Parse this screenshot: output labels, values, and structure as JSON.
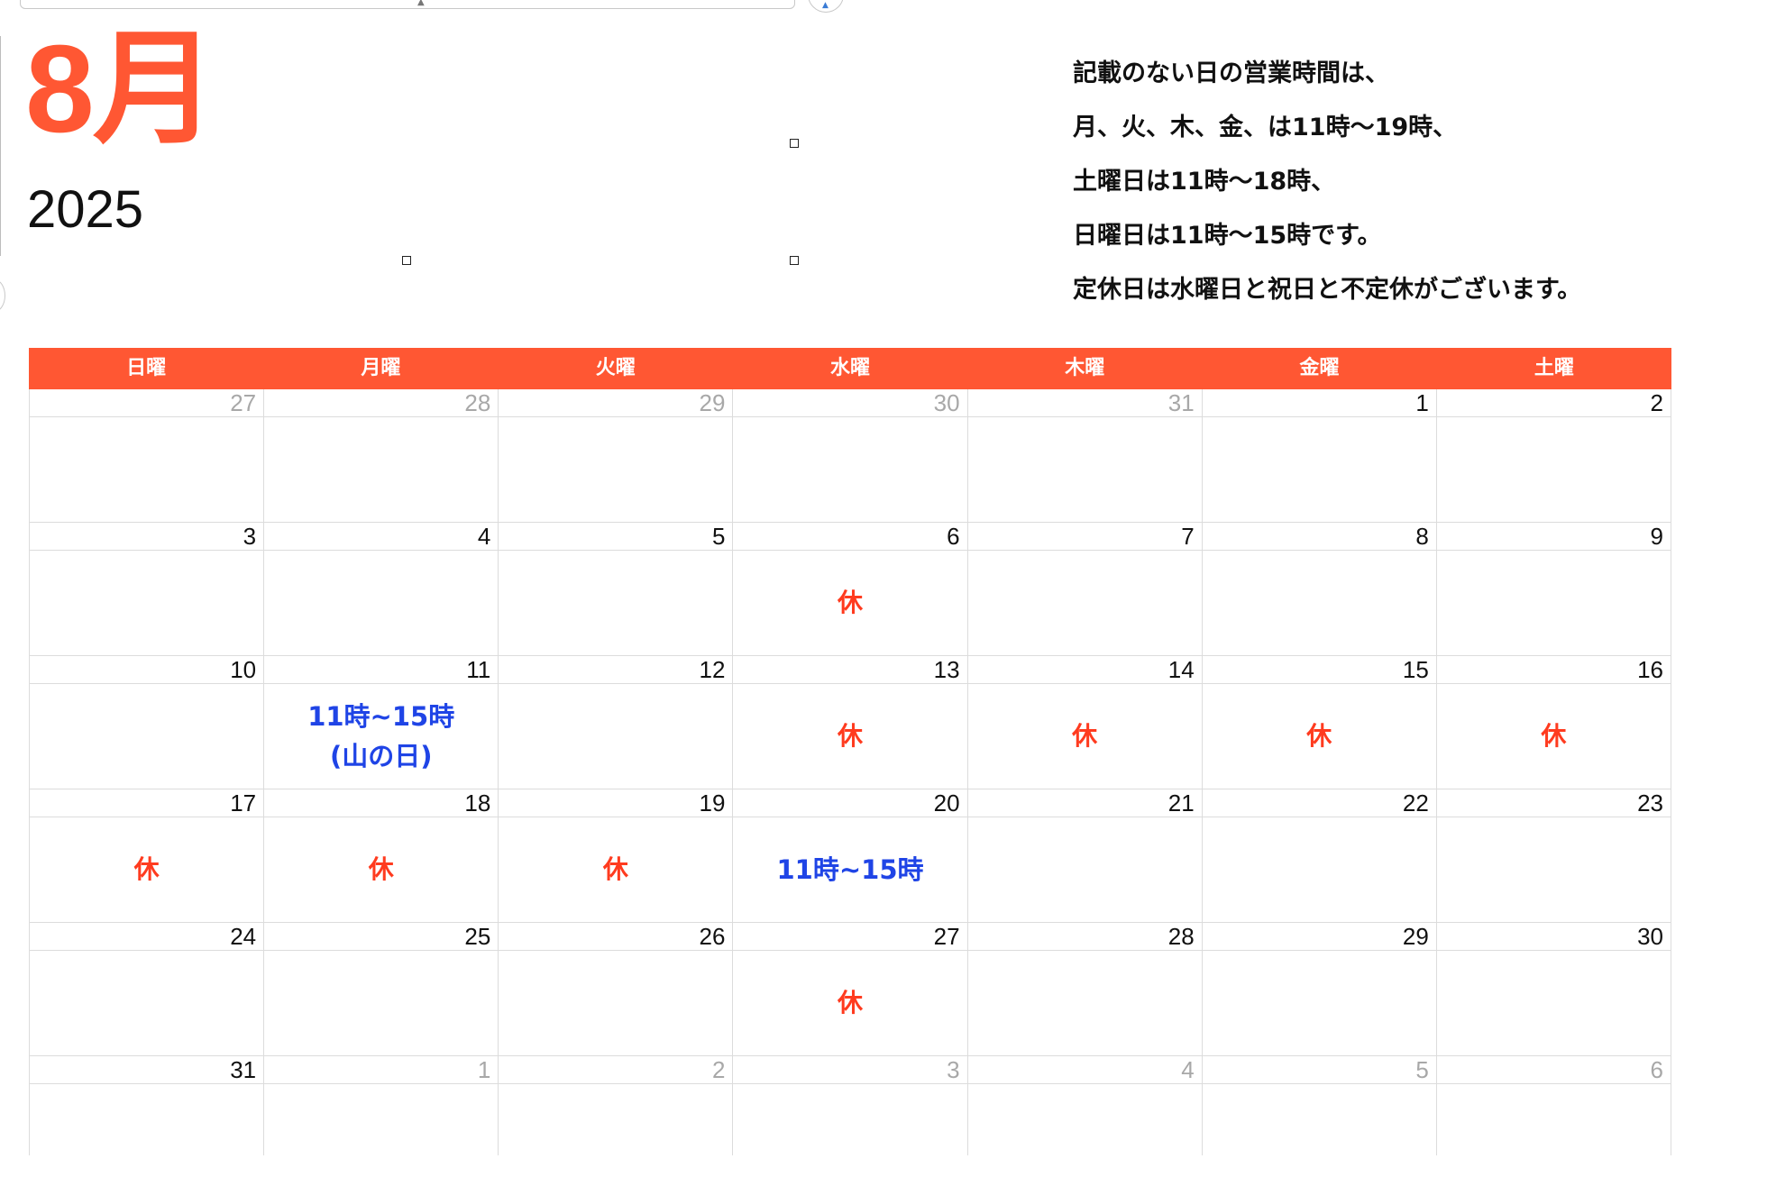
{
  "header": {
    "month": "8月",
    "year": "2025"
  },
  "notes": [
    "記載のない日の営業時間は、",
    "月、火、木、金、は11時〜19時、",
    "土曜日は11時〜18時、",
    "日曜日は11時〜15時です。",
    "定休日は水曜日と祝日と不定休がございます。"
  ],
  "weekdays": [
    "日曜",
    "月曜",
    "火曜",
    "水曜",
    "木曜",
    "金曜",
    "土曜"
  ],
  "colors": {
    "accent": "#ff5733",
    "closed": "#ff3b1f",
    "hours": "#1f44e6",
    "other_month": "#a8a8a8",
    "grid": "#dcdcdc"
  },
  "weeks": [
    [
      {
        "day": "27",
        "other": true,
        "event": null
      },
      {
        "day": "28",
        "other": true,
        "event": null
      },
      {
        "day": "29",
        "other": true,
        "event": null
      },
      {
        "day": "30",
        "other": true,
        "event": null
      },
      {
        "day": "31",
        "other": true,
        "event": null
      },
      {
        "day": "1",
        "other": false,
        "event": null
      },
      {
        "day": "2",
        "other": false,
        "event": null
      }
    ],
    [
      {
        "day": "3",
        "other": false,
        "event": null
      },
      {
        "day": "4",
        "other": false,
        "event": null
      },
      {
        "day": "5",
        "other": false,
        "event": null
      },
      {
        "day": "6",
        "other": false,
        "event": {
          "type": "closed",
          "lines": [
            "休"
          ]
        }
      },
      {
        "day": "7",
        "other": false,
        "event": null
      },
      {
        "day": "8",
        "other": false,
        "event": null
      },
      {
        "day": "9",
        "other": false,
        "event": null
      }
    ],
    [
      {
        "day": "10",
        "other": false,
        "event": null
      },
      {
        "day": "11",
        "other": false,
        "event": {
          "type": "hours",
          "lines": [
            "11時~15時",
            "(山の日)"
          ]
        }
      },
      {
        "day": "12",
        "other": false,
        "event": null
      },
      {
        "day": "13",
        "other": false,
        "event": {
          "type": "closed",
          "lines": [
            "休"
          ]
        }
      },
      {
        "day": "14",
        "other": false,
        "event": {
          "type": "closed",
          "lines": [
            "休"
          ]
        }
      },
      {
        "day": "15",
        "other": false,
        "event": {
          "type": "closed",
          "lines": [
            "休"
          ]
        }
      },
      {
        "day": "16",
        "other": false,
        "event": {
          "type": "closed",
          "lines": [
            "休"
          ]
        }
      }
    ],
    [
      {
        "day": "17",
        "other": false,
        "event": {
          "type": "closed",
          "lines": [
            "休"
          ]
        }
      },
      {
        "day": "18",
        "other": false,
        "event": {
          "type": "closed",
          "lines": [
            "休"
          ]
        }
      },
      {
        "day": "19",
        "other": false,
        "event": {
          "type": "closed",
          "lines": [
            "休"
          ]
        }
      },
      {
        "day": "20",
        "other": false,
        "event": {
          "type": "hours",
          "lines": [
            "11時~15時"
          ]
        }
      },
      {
        "day": "21",
        "other": false,
        "event": null
      },
      {
        "day": "22",
        "other": false,
        "event": null
      },
      {
        "day": "23",
        "other": false,
        "event": null
      }
    ],
    [
      {
        "day": "24",
        "other": false,
        "event": null
      },
      {
        "day": "25",
        "other": false,
        "event": null
      },
      {
        "day": "26",
        "other": false,
        "event": null
      },
      {
        "day": "27",
        "other": false,
        "event": {
          "type": "closed",
          "lines": [
            "休"
          ]
        }
      },
      {
        "day": "28",
        "other": false,
        "event": null
      },
      {
        "day": "29",
        "other": false,
        "event": null
      },
      {
        "day": "30",
        "other": false,
        "event": null
      }
    ],
    [
      {
        "day": "31",
        "other": false,
        "event": null
      },
      {
        "day": "1",
        "other": true,
        "event": null
      },
      {
        "day": "2",
        "other": true,
        "event": null
      },
      {
        "day": "3",
        "other": true,
        "event": null
      },
      {
        "day": "4",
        "other": true,
        "event": null
      },
      {
        "day": "5",
        "other": true,
        "event": null
      },
      {
        "day": "6",
        "other": true,
        "event": null
      }
    ]
  ]
}
